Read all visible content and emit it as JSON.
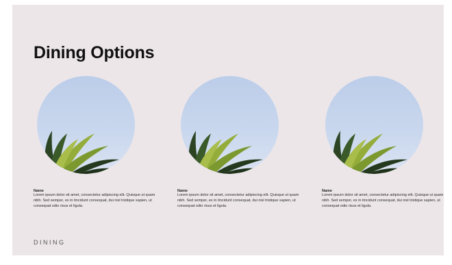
{
  "slide": {
    "title": "Dining Options",
    "footer": "DINING",
    "background_color": "#ece6e9"
  },
  "cards": [
    {
      "name": "Name",
      "description": "Lorem ipsum dolor sit amet, consectetur adipiscing elit. Quisque ut quam nibh. Sed semper, ex in tincidunt consequat, dui nisl tristique sapien, ut consequat odio risus et ligula.",
      "image": "palm-leaves-sky-photo"
    },
    {
      "name": "Name",
      "description": "Lorem ipsum dolor sit amet, consectetur adipiscing elit. Quisque ut quam nibh. Sed semper, ex in tincidunt consequat, dui nisl tristique sapien, ut consequat odio risus et ligula.",
      "image": "palm-leaves-sky-photo"
    },
    {
      "name": "Name",
      "description": "Lorem ipsum dolor sit amet, consectetur adipiscing elit. Quisque ut quam nibh. Sed semper, ex in tincidunt consequat, dui nisl tristique sapien, ut consequat odio risus et ligula.",
      "image": "palm-leaves-sky-photo"
    }
  ]
}
